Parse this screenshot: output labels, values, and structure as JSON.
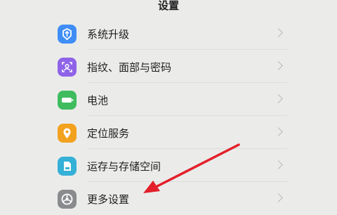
{
  "header": {
    "title": "设置"
  },
  "settings": {
    "items": [
      {
        "label": "系统升级",
        "icon": "system-update-icon",
        "color": "#3f8ef5"
      },
      {
        "label": "指纹、面部与密码",
        "icon": "fingerprint-face-icon",
        "color": "#8f63e8"
      },
      {
        "label": "电池",
        "icon": "battery-icon",
        "color": "#3fbc5e"
      },
      {
        "label": "定位服务",
        "icon": "location-icon",
        "color": "#f2a21e"
      },
      {
        "label": "运存与存储空间",
        "icon": "storage-icon",
        "color": "#35b0d6"
      },
      {
        "label": "更多设置",
        "icon": "more-settings-icon",
        "color": "#8a8b8d"
      }
    ]
  },
  "annotation": {
    "arrow_color": "#e3202a"
  }
}
